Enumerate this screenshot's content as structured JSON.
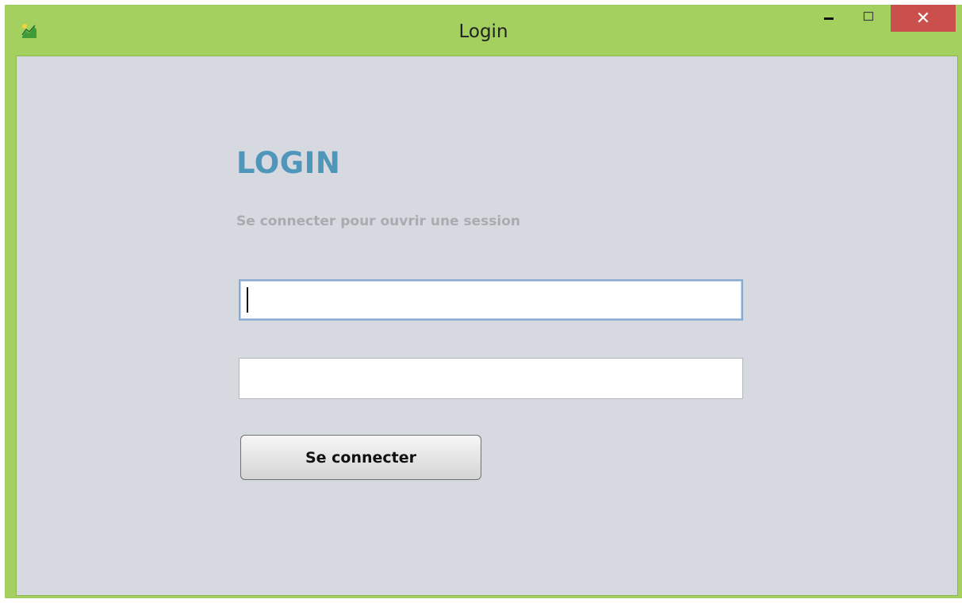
{
  "window": {
    "title": "Login",
    "close_glyph": "✕",
    "icon": "chart-app-icon"
  },
  "form": {
    "heading": "LOGIN",
    "subtitle": "Se connecter pour ouvrir une session",
    "username_value": "",
    "password_value": "",
    "submit_label": "Se connecter"
  },
  "colors": {
    "frame": "#a3d05e",
    "close_button": "#c9504c",
    "background": "#d6d9e0",
    "heading": "#4e97ba"
  }
}
